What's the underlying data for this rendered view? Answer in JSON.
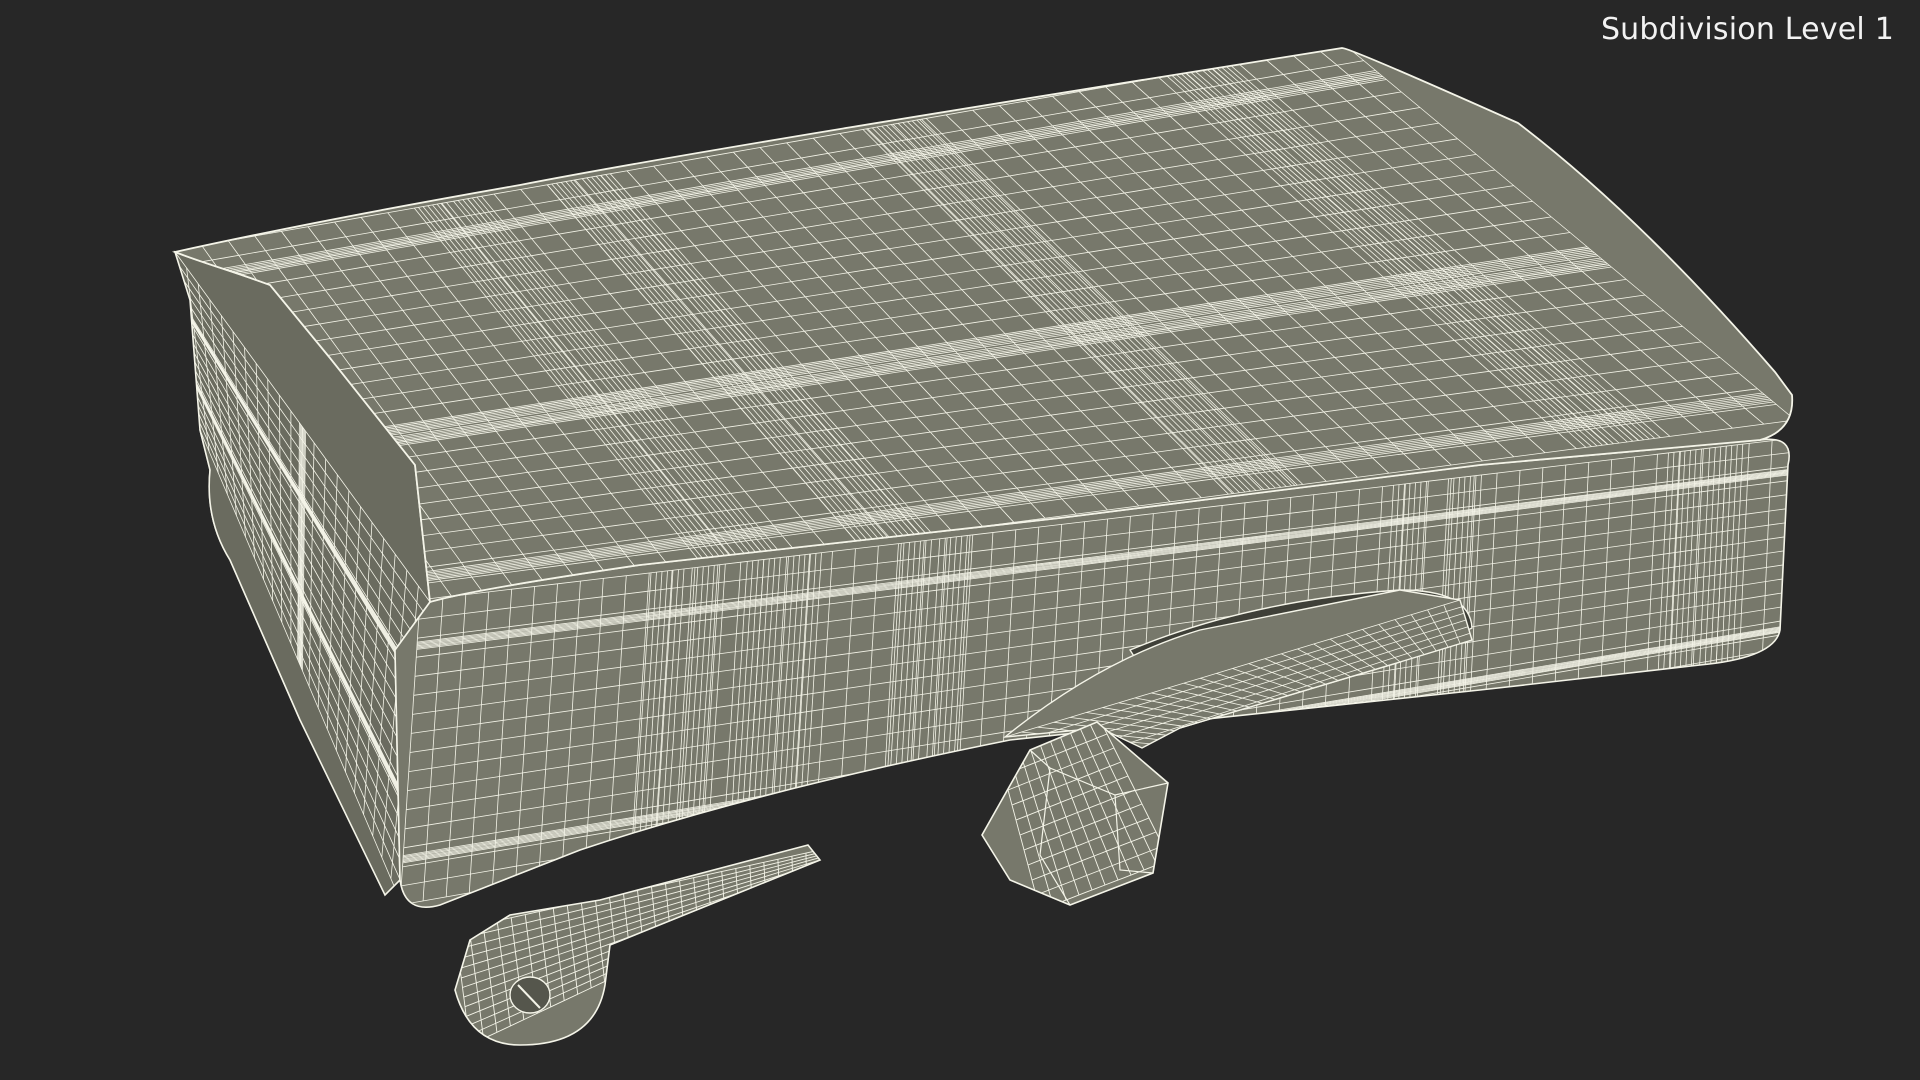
{
  "viewport": {
    "label": "Subdivision Level 1",
    "background_color": "#272727",
    "mesh_fill_color": "#77786b",
    "mesh_shade_color": "#55564c",
    "wire_color": "#f4f4e8"
  }
}
